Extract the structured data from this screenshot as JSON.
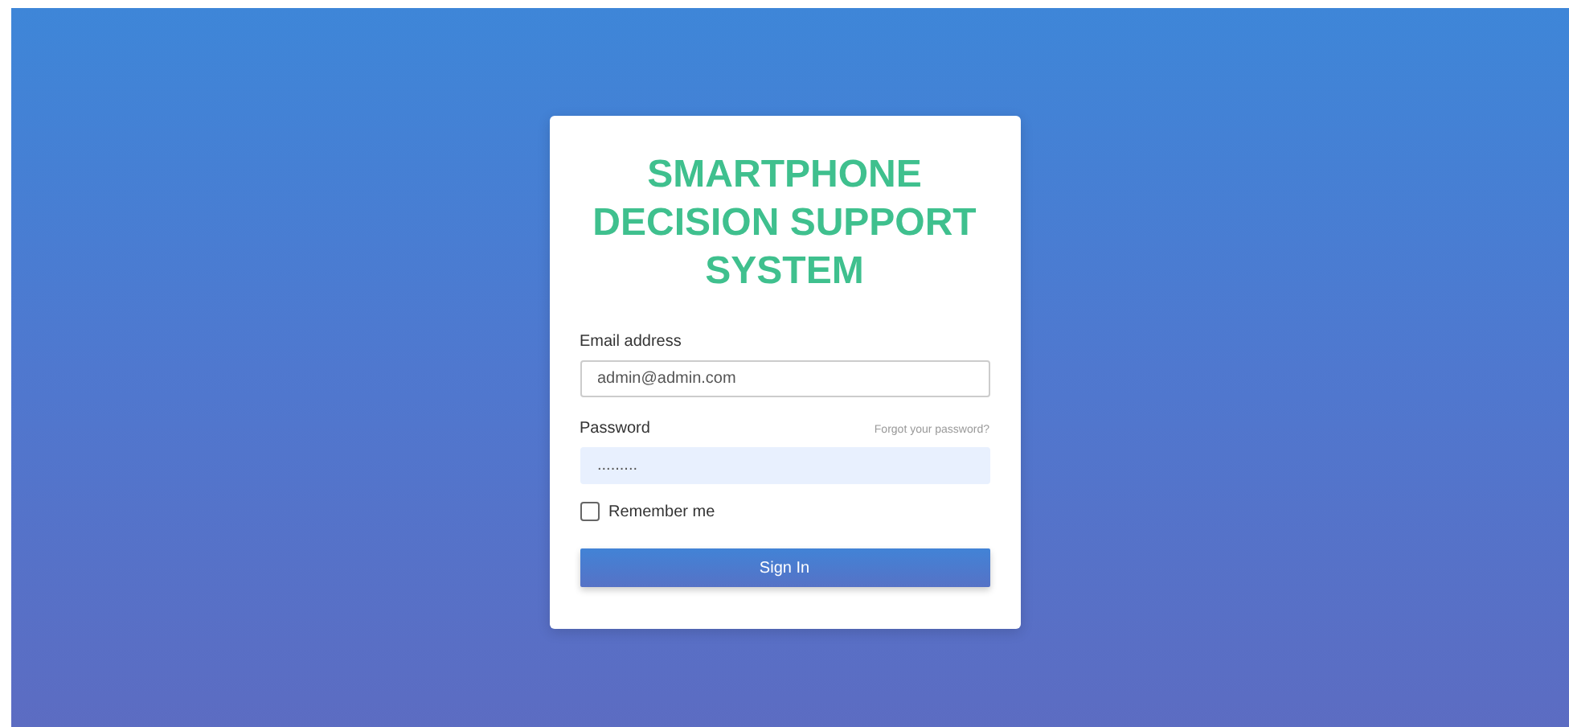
{
  "title": "SMARTPHONE DECISION SUPPORT SYSTEM",
  "email": {
    "label": "Email address",
    "value": "admin@admin.com"
  },
  "password": {
    "label": "Password",
    "value": ".........",
    "forgot_link": "Forgot your password?"
  },
  "remember": {
    "label": "Remember me",
    "checked": false
  },
  "button": "Sign In"
}
